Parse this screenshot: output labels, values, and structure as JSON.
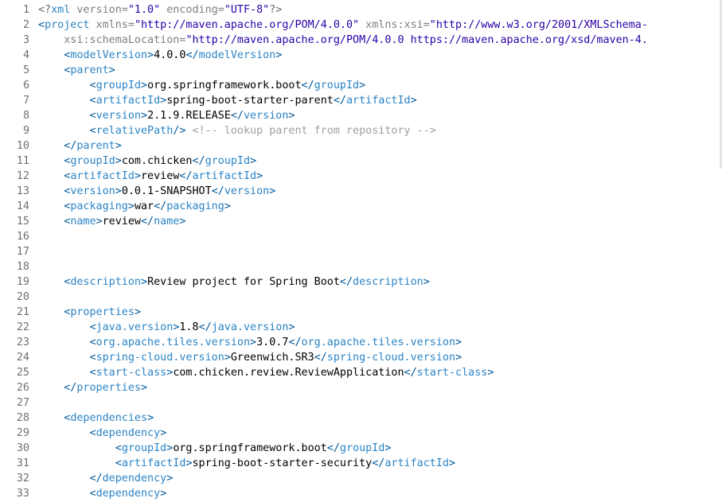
{
  "editor": {
    "colors": {
      "background": "#ffffff",
      "line_number": "#707070",
      "tag_bracket": "#005a9c",
      "tag_name": "#2b84c6",
      "attribute_name": "#7f7f7f",
      "attribute_value": "#2a00a8",
      "comment": "#9f9f9f",
      "text": "#000000"
    },
    "lines": [
      {
        "num": "1",
        "tokens": [
          [
            "pi",
            "<?"
          ],
          [
            "tag",
            "xml"
          ],
          [
            "attr",
            " version="
          ],
          [
            "str",
            "\"1.0\""
          ],
          [
            "attr",
            " encoding="
          ],
          [
            "str",
            "\"UTF-8\""
          ],
          [
            "pi",
            "?>"
          ]
        ]
      },
      {
        "num": "2",
        "tokens": [
          [
            "bracket",
            "<"
          ],
          [
            "tag",
            "project"
          ],
          [
            "attr",
            " xmlns="
          ],
          [
            "str",
            "\"http://maven.apache.org/POM/4.0.0\""
          ],
          [
            "attr",
            " xmlns:xsi="
          ],
          [
            "str",
            "\"http://www.w3.org/2001/XMLSchema-"
          ]
        ]
      },
      {
        "num": "3",
        "tokens": [
          [
            "attr",
            "    xsi:schemaLocation="
          ],
          [
            "str",
            "\"http://maven.apache.org/POM/4.0.0 https://maven.apache.org/xsd/maven-4."
          ]
        ]
      },
      {
        "num": "4",
        "tokens": [
          [
            "text",
            "    "
          ],
          [
            "bracket",
            "<"
          ],
          [
            "tag",
            "modelVersion"
          ],
          [
            "bracket",
            ">"
          ],
          [
            "text",
            "4.0.0"
          ],
          [
            "bracket",
            "</"
          ],
          [
            "tag",
            "modelVersion"
          ],
          [
            "bracket",
            ">"
          ]
        ]
      },
      {
        "num": "5",
        "tokens": [
          [
            "text",
            "    "
          ],
          [
            "bracket",
            "<"
          ],
          [
            "tag",
            "parent"
          ],
          [
            "bracket",
            ">"
          ]
        ]
      },
      {
        "num": "6",
        "tokens": [
          [
            "text",
            "        "
          ],
          [
            "bracket",
            "<"
          ],
          [
            "tag",
            "groupId"
          ],
          [
            "bracket",
            ">"
          ],
          [
            "text",
            "org.springframework.boot"
          ],
          [
            "bracket",
            "</"
          ],
          [
            "tag",
            "groupId"
          ],
          [
            "bracket",
            ">"
          ]
        ]
      },
      {
        "num": "7",
        "tokens": [
          [
            "text",
            "        "
          ],
          [
            "bracket",
            "<"
          ],
          [
            "tag",
            "artifactId"
          ],
          [
            "bracket",
            ">"
          ],
          [
            "text",
            "spring-boot-starter-parent"
          ],
          [
            "bracket",
            "</"
          ],
          [
            "tag",
            "artifactId"
          ],
          [
            "bracket",
            ">"
          ]
        ]
      },
      {
        "num": "8",
        "tokens": [
          [
            "text",
            "        "
          ],
          [
            "bracket",
            "<"
          ],
          [
            "tag",
            "version"
          ],
          [
            "bracket",
            ">"
          ],
          [
            "text",
            "2.1.9.RELEASE"
          ],
          [
            "bracket",
            "</"
          ],
          [
            "tag",
            "version"
          ],
          [
            "bracket",
            ">"
          ]
        ]
      },
      {
        "num": "9",
        "tokens": [
          [
            "text",
            "        "
          ],
          [
            "bracket",
            "<"
          ],
          [
            "tag",
            "relativePath"
          ],
          [
            "bracket",
            "/> "
          ],
          [
            "comment",
            "<!-- lookup parent from repository -->"
          ]
        ]
      },
      {
        "num": "10",
        "tokens": [
          [
            "text",
            "    "
          ],
          [
            "bracket",
            "</"
          ],
          [
            "tag",
            "parent"
          ],
          [
            "bracket",
            ">"
          ]
        ]
      },
      {
        "num": "11",
        "tokens": [
          [
            "text",
            "    "
          ],
          [
            "bracket",
            "<"
          ],
          [
            "tag",
            "groupId"
          ],
          [
            "bracket",
            ">"
          ],
          [
            "text",
            "com.chicken"
          ],
          [
            "bracket",
            "</"
          ],
          [
            "tag",
            "groupId"
          ],
          [
            "bracket",
            ">"
          ]
        ]
      },
      {
        "num": "12",
        "tokens": [
          [
            "text",
            "    "
          ],
          [
            "bracket",
            "<"
          ],
          [
            "tag",
            "artifactId"
          ],
          [
            "bracket",
            ">"
          ],
          [
            "text",
            "review"
          ],
          [
            "bracket",
            "</"
          ],
          [
            "tag",
            "artifactId"
          ],
          [
            "bracket",
            ">"
          ]
        ]
      },
      {
        "num": "13",
        "tokens": [
          [
            "text",
            "    "
          ],
          [
            "bracket",
            "<"
          ],
          [
            "tag",
            "version"
          ],
          [
            "bracket",
            ">"
          ],
          [
            "text",
            "0.0.1-SNAPSHOT"
          ],
          [
            "bracket",
            "</"
          ],
          [
            "tag",
            "version"
          ],
          [
            "bracket",
            ">"
          ]
        ]
      },
      {
        "num": "14",
        "tokens": [
          [
            "text",
            "    "
          ],
          [
            "bracket",
            "<"
          ],
          [
            "tag",
            "packaging"
          ],
          [
            "bracket",
            ">"
          ],
          [
            "text",
            "war"
          ],
          [
            "bracket",
            "</"
          ],
          [
            "tag",
            "packaging"
          ],
          [
            "bracket",
            ">"
          ]
        ]
      },
      {
        "num": "15",
        "tokens": [
          [
            "text",
            "    "
          ],
          [
            "bracket",
            "<"
          ],
          [
            "tag",
            "name"
          ],
          [
            "bracket",
            ">"
          ],
          [
            "text",
            "review"
          ],
          [
            "bracket",
            "</"
          ],
          [
            "tag",
            "name"
          ],
          [
            "bracket",
            ">"
          ]
        ]
      },
      {
        "num": "16",
        "tokens": []
      },
      {
        "num": "17",
        "tokens": []
      },
      {
        "num": "18",
        "tokens": []
      },
      {
        "num": "19",
        "tokens": [
          [
            "text",
            "    "
          ],
          [
            "bracket",
            "<"
          ],
          [
            "tag",
            "description"
          ],
          [
            "bracket",
            ">"
          ],
          [
            "text",
            "Review project for Spring Boot"
          ],
          [
            "bracket",
            "</"
          ],
          [
            "tag",
            "description"
          ],
          [
            "bracket",
            ">"
          ]
        ]
      },
      {
        "num": "20",
        "tokens": []
      },
      {
        "num": "21",
        "tokens": [
          [
            "text",
            "    "
          ],
          [
            "bracket",
            "<"
          ],
          [
            "tag",
            "properties"
          ],
          [
            "bracket",
            ">"
          ]
        ]
      },
      {
        "num": "22",
        "tokens": [
          [
            "text",
            "        "
          ],
          [
            "bracket",
            "<"
          ],
          [
            "tag",
            "java.version"
          ],
          [
            "bracket",
            ">"
          ],
          [
            "text",
            "1.8"
          ],
          [
            "bracket",
            "</"
          ],
          [
            "tag",
            "java.version"
          ],
          [
            "bracket",
            ">"
          ]
        ]
      },
      {
        "num": "23",
        "tokens": [
          [
            "text",
            "        "
          ],
          [
            "bracket",
            "<"
          ],
          [
            "tag",
            "org.apache.tiles.version"
          ],
          [
            "bracket",
            ">"
          ],
          [
            "text",
            "3.0.7"
          ],
          [
            "bracket",
            "</"
          ],
          [
            "tag",
            "org.apache.tiles.version"
          ],
          [
            "bracket",
            ">"
          ]
        ]
      },
      {
        "num": "24",
        "tokens": [
          [
            "text",
            "        "
          ],
          [
            "bracket",
            "<"
          ],
          [
            "tag",
            "spring-cloud.version"
          ],
          [
            "bracket",
            ">"
          ],
          [
            "text",
            "Greenwich.SR3"
          ],
          [
            "bracket",
            "</"
          ],
          [
            "tag",
            "spring-cloud.version"
          ],
          [
            "bracket",
            ">"
          ]
        ]
      },
      {
        "num": "25",
        "tokens": [
          [
            "text",
            "        "
          ],
          [
            "bracket",
            "<"
          ],
          [
            "tag",
            "start-class"
          ],
          [
            "bracket",
            ">"
          ],
          [
            "text",
            "com.chicken.review.ReviewApplication"
          ],
          [
            "bracket",
            "</"
          ],
          [
            "tag",
            "start-class"
          ],
          [
            "bracket",
            ">"
          ]
        ]
      },
      {
        "num": "26",
        "tokens": [
          [
            "text",
            "    "
          ],
          [
            "bracket",
            "</"
          ],
          [
            "tag",
            "properties"
          ],
          [
            "bracket",
            ">"
          ]
        ]
      },
      {
        "num": "27",
        "tokens": []
      },
      {
        "num": "28",
        "tokens": [
          [
            "text",
            "    "
          ],
          [
            "bracket",
            "<"
          ],
          [
            "tag",
            "dependencies"
          ],
          [
            "bracket",
            ">"
          ]
        ]
      },
      {
        "num": "29",
        "tokens": [
          [
            "text",
            "        "
          ],
          [
            "bracket",
            "<"
          ],
          [
            "tag",
            "dependency"
          ],
          [
            "bracket",
            ">"
          ]
        ]
      },
      {
        "num": "30",
        "tokens": [
          [
            "text",
            "            "
          ],
          [
            "bracket",
            "<"
          ],
          [
            "tag",
            "groupId"
          ],
          [
            "bracket",
            ">"
          ],
          [
            "text",
            "org.springframework.boot"
          ],
          [
            "bracket",
            "</"
          ],
          [
            "tag",
            "groupId"
          ],
          [
            "bracket",
            ">"
          ]
        ]
      },
      {
        "num": "31",
        "tokens": [
          [
            "text",
            "            "
          ],
          [
            "bracket",
            "<"
          ],
          [
            "tag",
            "artifactId"
          ],
          [
            "bracket",
            ">"
          ],
          [
            "text",
            "spring-boot-starter-security"
          ],
          [
            "bracket",
            "</"
          ],
          [
            "tag",
            "artifactId"
          ],
          [
            "bracket",
            ">"
          ]
        ]
      },
      {
        "num": "32",
        "tokens": [
          [
            "text",
            "        "
          ],
          [
            "bracket",
            "</"
          ],
          [
            "tag",
            "dependency"
          ],
          [
            "bracket",
            ">"
          ]
        ]
      },
      {
        "num": "33",
        "tokens": [
          [
            "text",
            "        "
          ],
          [
            "bracket",
            "<"
          ],
          [
            "tag",
            "dependency"
          ],
          [
            "bracket",
            ">"
          ]
        ]
      }
    ]
  }
}
